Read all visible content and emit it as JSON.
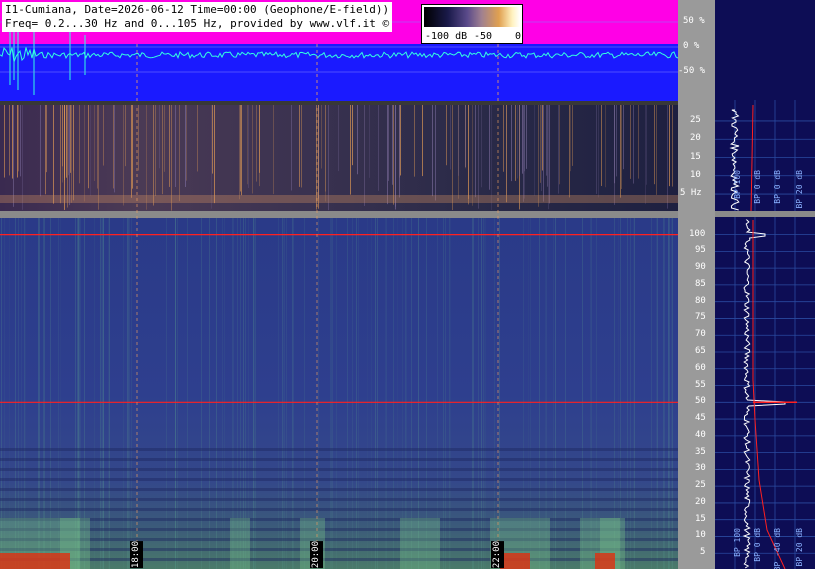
{
  "header": {
    "title_line1": "I1-Cumiana, Date=2026-06-12 Time=00:00 (Geophone/E-field))",
    "title_line2": "Freq= 0.2...30 Hz and 0...105 Hz, provided by www.vlf.it ©"
  },
  "colorbar": {
    "labels": [
      "-100 dB",
      "-50",
      "0"
    ]
  },
  "amplitude_axis": {
    "labels": [
      "50 %",
      "0 %",
      "-50 %"
    ]
  },
  "low_freq_axis": {
    "labels": [
      "25",
      "20",
      "15",
      "10",
      "5 Hz"
    ]
  },
  "main_freq_axis": {
    "labels": [
      "100",
      "95",
      "90",
      "85",
      "80",
      "75",
      "70",
      "65",
      "60",
      "55",
      "50",
      "45",
      "40",
      "35",
      "30",
      "25",
      "20",
      "15",
      "10",
      "5"
    ]
  },
  "time_axis": {
    "labels": [
      "18:00",
      "20:00",
      "22:00"
    ]
  },
  "side_panel": {
    "bp_labels_low": [
      "BP 100",
      "BP 0 dB",
      "BP 0 dB",
      "BP 20 dB"
    ],
    "bp_labels_main": [
      "BP 100",
      "BP 0 dB",
      "BP -40 dB",
      "BP 20 dB"
    ]
  },
  "colors": {
    "waveform_band": "#ff00e6",
    "waveform_background": "#1a1aff",
    "waveform_trace": "#33ffe0",
    "line_50hz": "#ff2020",
    "line_100hz": "#ff2020",
    "side_background": "#0d0d55"
  },
  "chart_data": [
    {
      "type": "line",
      "title": "I1-Cumiana, Date=2026-06-12 Time=00:00 (Geophone/E-field))",
      "xlabel": "",
      "ylabel": "",
      "y_ticks": [
        "50 %",
        "0 %",
        "-50 %"
      ],
      "ylim": [
        -75,
        75
      ]
    },
    {
      "type": "heatmap",
      "title": "",
      "y_ticks": [
        5,
        10,
        15,
        20,
        25
      ],
      "ylim": [
        0.2,
        30
      ],
      "y_unit": "Hz",
      "x_ticks": [
        "18:00",
        "20:00",
        "22:00"
      ]
    },
    {
      "type": "heatmap",
      "title": "",
      "y_ticks": [
        5,
        10,
        15,
        20,
        25,
        30,
        35,
        40,
        45,
        50,
        55,
        60,
        65,
        70,
        75,
        80,
        85,
        90,
        95,
        100
      ],
      "ylim": [
        0,
        105
      ],
      "x_ticks": [
        "18:00",
        "20:00",
        "22:00"
      ],
      "strong_lines_hz": [
        50,
        100
      ],
      "colorbar": {
        "labels": [
          "-100 dB",
          "-50",
          "0"
        ],
        "range_db": [
          -100,
          0
        ]
      }
    }
  ]
}
